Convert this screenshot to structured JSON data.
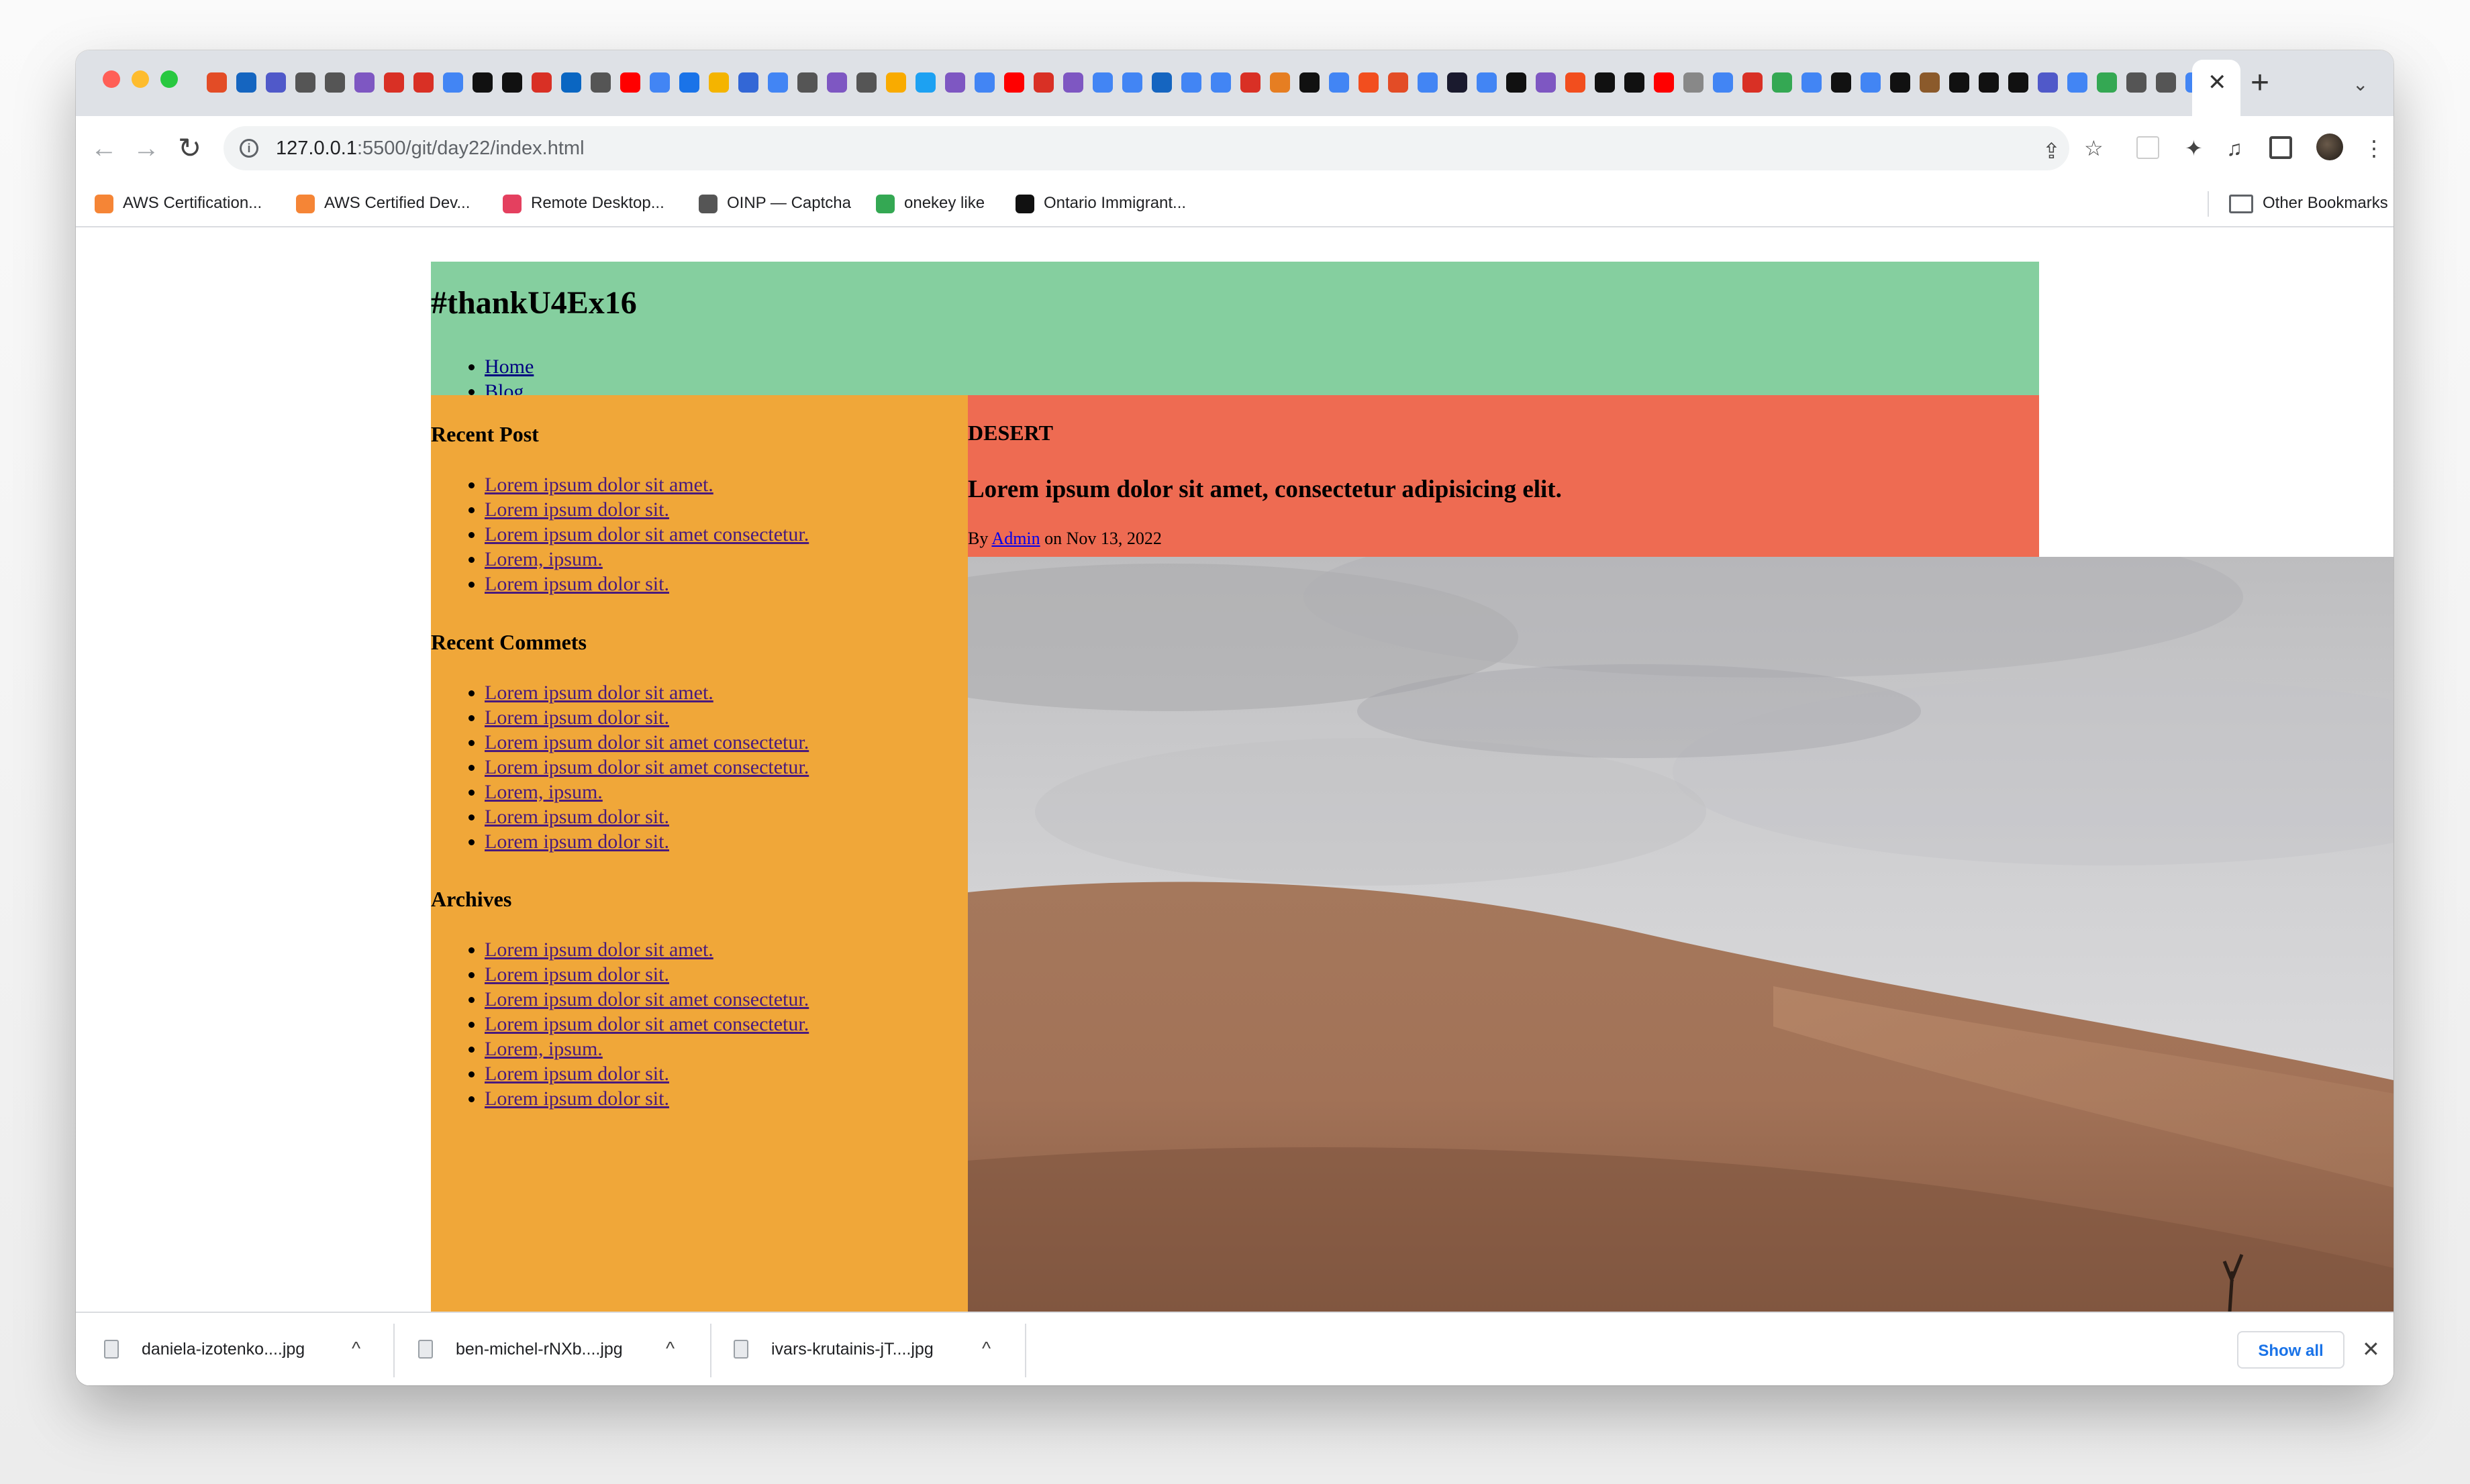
{
  "browser": {
    "address_bar": {
      "host": "127.0.0.1",
      "port_path": ":5500/git/day22/index.html"
    },
    "tab_close": "✕",
    "new_tab": "+",
    "tab_search": "⌄",
    "nav": {
      "back": "←",
      "forward": "→",
      "reload": "↻"
    },
    "toolbar_icons": {
      "share": "⇪",
      "star": "☆",
      "puzzle": "✦",
      "media": "♫",
      "menu": "⋮"
    },
    "tab_favicon_colors": [
      "#e34c26",
      "#1565c0",
      "#5059c9",
      "#555555",
      "#555555",
      "#7e57c2",
      "#d93025",
      "#d93025",
      "#4285f4",
      "#111111",
      "#111111",
      "#d93025",
      "#0a66c2",
      "#555555",
      "#ff0000",
      "#4285f4",
      "#1a73e8",
      "#f4b400",
      "#3367d6",
      "#4285f4",
      "#555555",
      "#7e57c2",
      "#555555",
      "#f9ab00",
      "#1da1f2",
      "#7e57c2",
      "#4285f4",
      "#ff0000",
      "#d93025",
      "#7e57c2",
      "#4285f4",
      "#4285f4",
      "#1565c0",
      "#4285f4",
      "#4285f4",
      "#d93025",
      "#e67e22",
      "#111111",
      "#4285f4",
      "#f24e1e",
      "#e34c26",
      "#4285f4",
      "#1a1a2e",
      "#4285f4",
      "#111111",
      "#7e57c2",
      "#f24e1e",
      "#111111",
      "#111111",
      "#ff0000",
      "#888888",
      "#4285f4",
      "#d93025",
      "#34a853",
      "#4285f4",
      "#111111",
      "#4285f4",
      "#111111",
      "#8b5a2b",
      "#111111",
      "#111111",
      "#111111",
      "#5059c9",
      "#4285f4",
      "#34a853",
      "#555555",
      "#555555",
      "#4285f4"
    ]
  },
  "bookmarks": [
    {
      "label": "AWS Certification...",
      "color": "#f58536"
    },
    {
      "label": "AWS Certified Dev...",
      "color": "#f58536"
    },
    {
      "label": "Remote Desktop...",
      "color": "#e4405f"
    },
    {
      "label": "OINP — Captcha",
      "color": "#555555"
    },
    {
      "label": "onekey like",
      "color": "#34a853"
    },
    {
      "label": "Ontario Immigrant...",
      "color": "#111111"
    }
  ],
  "other_bookmarks": "Other Bookmarks",
  "page": {
    "site_title": "#thankU4Ex16",
    "nav": [
      "Home",
      "Blog"
    ],
    "colors": {
      "header": "#85cf9f",
      "sidebar": "#f0a739",
      "post_header": "#ee6b52"
    },
    "sidebar": {
      "recent_post": {
        "title": "Recent Post",
        "items": [
          "Lorem ipsum dolor sit amet.",
          "Lorem ipsum dolor sit.",
          "Lorem ipsum dolor sit amet consectetur.",
          "Lorem, ipsum.",
          "Lorem ipsum dolor sit."
        ]
      },
      "recent_comments": {
        "title": "Recent Commets",
        "items": [
          "Lorem ipsum dolor sit amet.",
          "Lorem ipsum dolor sit.",
          "Lorem ipsum dolor sit amet consectetur.",
          "Lorem ipsum dolor sit amet consectetur.",
          "Lorem, ipsum.",
          "Lorem ipsum dolor sit.",
          "Lorem ipsum dolor sit."
        ]
      },
      "archives": {
        "title": "Archives",
        "items": [
          "Lorem ipsum dolor sit amet.",
          "Lorem ipsum dolor sit.",
          "Lorem ipsum dolor sit amet consectetur.",
          "Lorem ipsum dolor sit amet consectetur.",
          "Lorem, ipsum.",
          "Lorem ipsum dolor sit.",
          "Lorem ipsum dolor sit."
        ]
      }
    },
    "post": {
      "category": "DESERT",
      "title": "Lorem ipsum dolor sit amet, consectetur adipisicing elit.",
      "meta_by": "By ",
      "author": "Admin",
      "meta_on": " on Nov 13, 2022"
    }
  },
  "downloads": {
    "items": [
      "daniela-izotenko....jpg",
      "ben-michel-rNXb....jpg",
      "ivars-krutainis-jT....jpg"
    ],
    "caret": "^",
    "show_all": "Show all",
    "close": "✕"
  }
}
